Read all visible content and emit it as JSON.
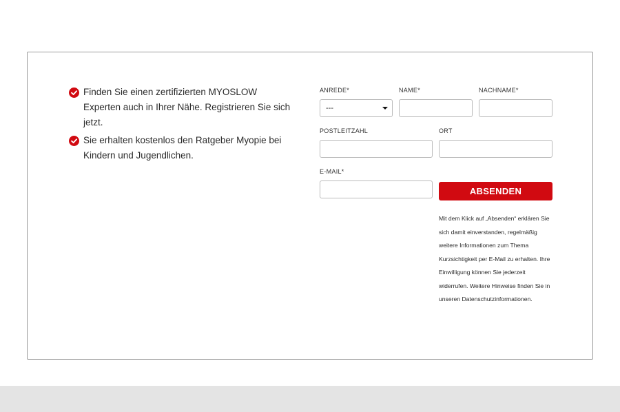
{
  "benefits": [
    {
      "icon": "check-circle-icon",
      "text": "Finden Sie einen zertifizierten MYOSLOW Experten auch in Ihrer Nähe. Registrieren Sie sich jetzt."
    },
    {
      "icon": "check-circle-icon",
      "text": "Sie erhalten kostenlos den Ratgeber Myopie bei Kindern und Jugendlichen."
    }
  ],
  "form": {
    "anrede": {
      "label": "ANREDE*",
      "value": "---"
    },
    "name": {
      "label": "NAME*",
      "value": ""
    },
    "nachname": {
      "label": "NACHNAME*",
      "value": ""
    },
    "postleitzahl": {
      "label": "POSTLEITZAHL",
      "value": ""
    },
    "ort": {
      "label": "ORT",
      "value": ""
    },
    "email": {
      "label": "E-MAIL*",
      "value": ""
    },
    "submit_label": "ABSENDEN",
    "consent_text": "Mit dem Klick auf „Absenden“ erklären Sie sich damit einverstanden, regelmäßig weitere Informationen zum Thema Kurzsichtigkeit per E-Mail zu erhalten. Ihre Einwilligung können Sie jederzeit widerrufen. Weitere Hinweise finden Sie in unseren Datenschutzinformationen."
  },
  "colors": {
    "accent": "#d10a11",
    "border": "#b9b9b9",
    "footer_band": "#e4e4e4"
  }
}
